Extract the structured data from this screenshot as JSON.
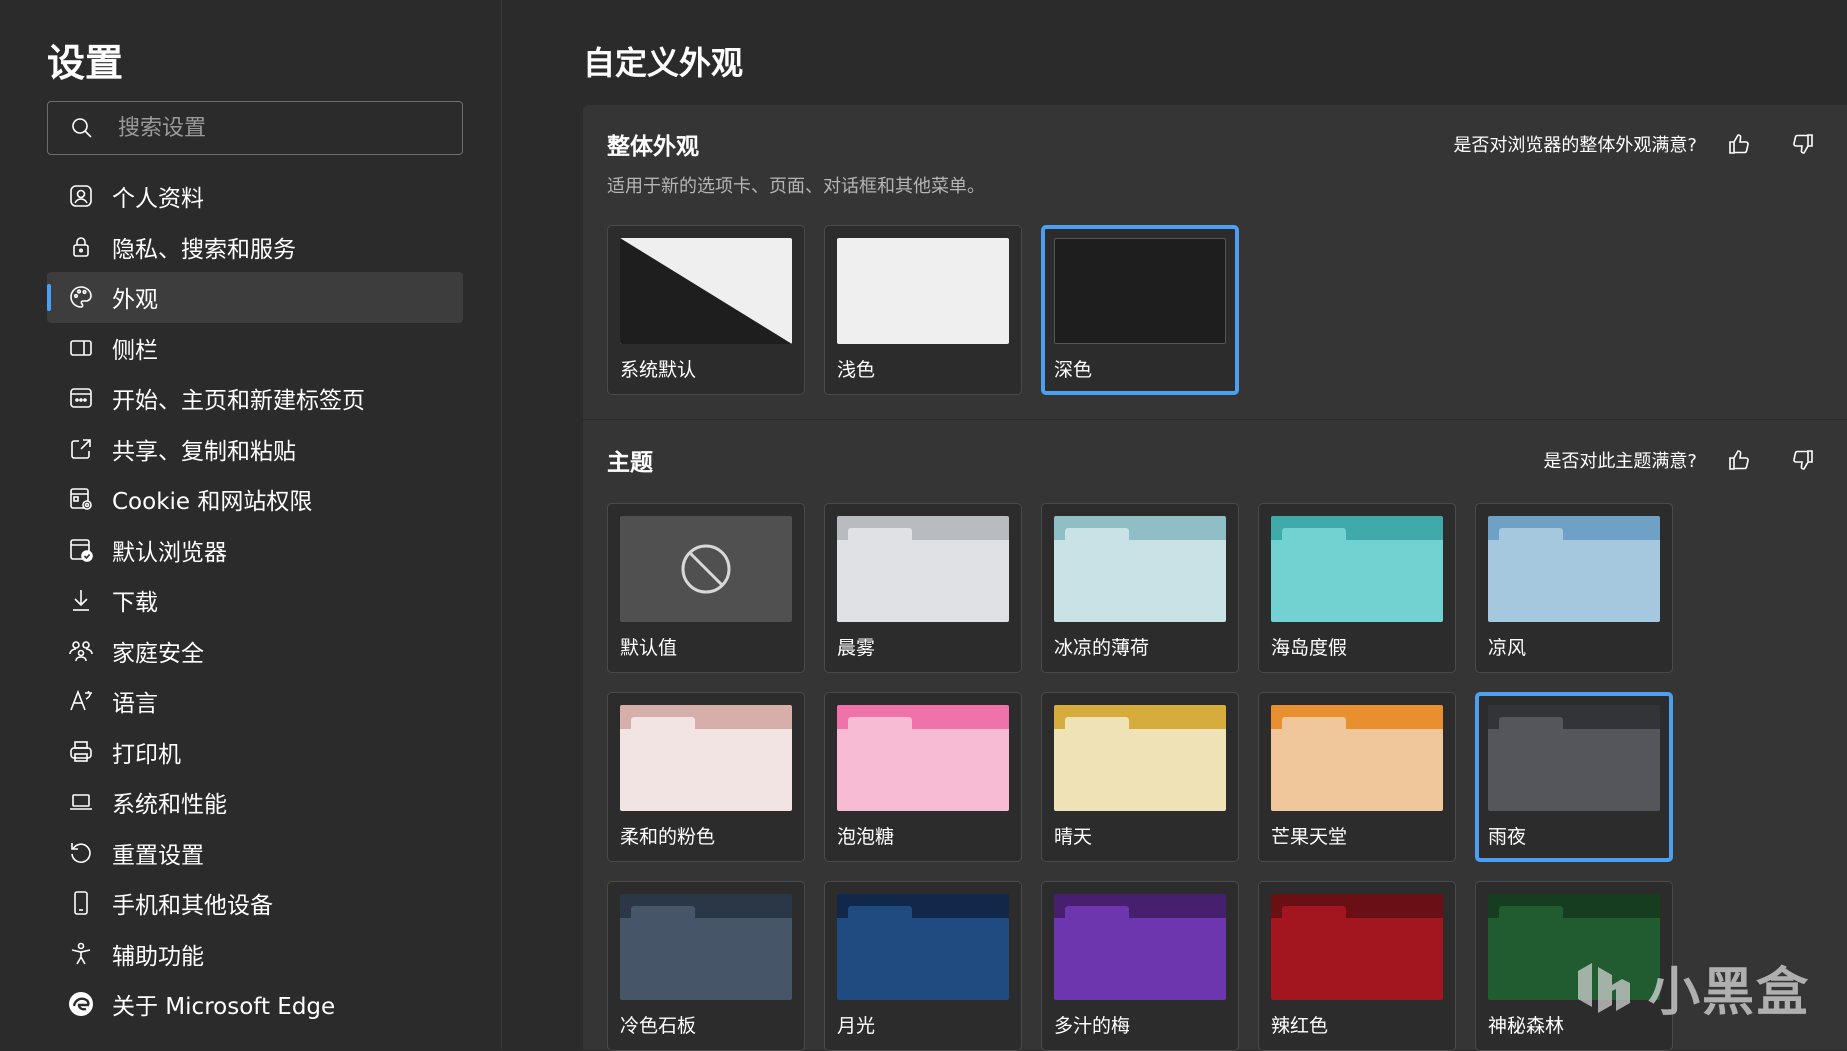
{
  "sidebar": {
    "title": "设置",
    "search_placeholder": "搜索设置",
    "items": [
      {
        "label": "个人资料",
        "icon": "profile-icon"
      },
      {
        "label": "隐私、搜索和服务",
        "icon": "lock-icon"
      },
      {
        "label": "外观",
        "icon": "palette-icon",
        "active": true
      },
      {
        "label": "侧栏",
        "icon": "sidebar-icon"
      },
      {
        "label": "开始、主页和新建标签页",
        "icon": "home-tab-icon"
      },
      {
        "label": "共享、复制和粘贴",
        "icon": "share-icon"
      },
      {
        "label": "Cookie 和网站权限",
        "icon": "cookie-icon"
      },
      {
        "label": "默认浏览器",
        "icon": "default-browser-icon"
      },
      {
        "label": "下载",
        "icon": "download-icon"
      },
      {
        "label": "家庭安全",
        "icon": "family-icon"
      },
      {
        "label": "语言",
        "icon": "language-icon"
      },
      {
        "label": "打印机",
        "icon": "printer-icon"
      },
      {
        "label": "系统和性能",
        "icon": "laptop-icon"
      },
      {
        "label": "重置设置",
        "icon": "reset-icon"
      },
      {
        "label": "手机和其他设备",
        "icon": "phone-icon"
      },
      {
        "label": "辅助功能",
        "icon": "accessibility-icon"
      },
      {
        "label": "关于 Microsoft Edge",
        "icon": "edge-icon"
      }
    ]
  },
  "main": {
    "title": "自定义外观",
    "overall": {
      "heading": "整体外观",
      "description": "适用于新的选项卡、页面、对话框和其他菜单。",
      "feedback_question": "是否对浏览器的整体外观满意?",
      "options": [
        {
          "label": "系统默认",
          "preview": "system"
        },
        {
          "label": "浅色",
          "preview": "light",
          "color": "#efefef"
        },
        {
          "label": "深色",
          "preview": "dark",
          "color": "#1e1e1e",
          "selected": true
        }
      ]
    },
    "themes": {
      "heading": "主题",
      "feedback_question": "是否对此主题满意?",
      "items": [
        {
          "label": "默认值",
          "default": true
        },
        {
          "label": "晨雾",
          "top": "#b8bcc1",
          "body": "#dfe1e4",
          "tab": "#dfe1e4"
        },
        {
          "label": "冰凉的薄荷",
          "top": "#8fbec6",
          "body": "#c9e2e6",
          "tab": "#c9e2e6"
        },
        {
          "label": "海岛度假",
          "top": "#40a9a9",
          "body": "#72d1d1",
          "tab": "#72d1d1"
        },
        {
          "label": "凉风",
          "top": "#6fa0c5",
          "body": "#a6c8df",
          "tab": "#a6c8df"
        },
        {
          "label": "柔和的粉色",
          "top": "#d6afab",
          "body": "#f1e4e2",
          "tab": "#f1e4e2"
        },
        {
          "label": "泡泡糖",
          "top": "#ef72a8",
          "body": "#f7bbd3",
          "tab": "#f7bbd3"
        },
        {
          "label": "晴天",
          "top": "#d6ad3c",
          "body": "#efe2b6",
          "tab": "#efe2b6"
        },
        {
          "label": "芒果天堂",
          "top": "#e88f2f",
          "body": "#f0c79a",
          "tab": "#f0c79a"
        },
        {
          "label": "雨夜",
          "top": "#333437",
          "body": "#54565b",
          "tab": "#54565b",
          "selected": true
        },
        {
          "label": "冷色石板",
          "top": "#2b3647",
          "body": "#475569",
          "tab": "#475569"
        },
        {
          "label": "月光",
          "top": "#11284a",
          "body": "#1f4b80",
          "tab": "#1f4b80"
        },
        {
          "label": "多汁的梅",
          "top": "#46206f",
          "body": "#6d36ae",
          "tab": "#6d36ae"
        },
        {
          "label": "辣红色",
          "top": "#6a0f13",
          "body": "#a3161f",
          "tab": "#a3161f"
        },
        {
          "label": "神秘森林",
          "top": "#173d21",
          "body": "#215c30",
          "tab": "#215c30"
        }
      ]
    }
  },
  "watermark": {
    "text": "小黑盒"
  },
  "colors": {
    "accent": "#4ba0f2",
    "panel": "#353535",
    "background": "#2b2b2b"
  }
}
